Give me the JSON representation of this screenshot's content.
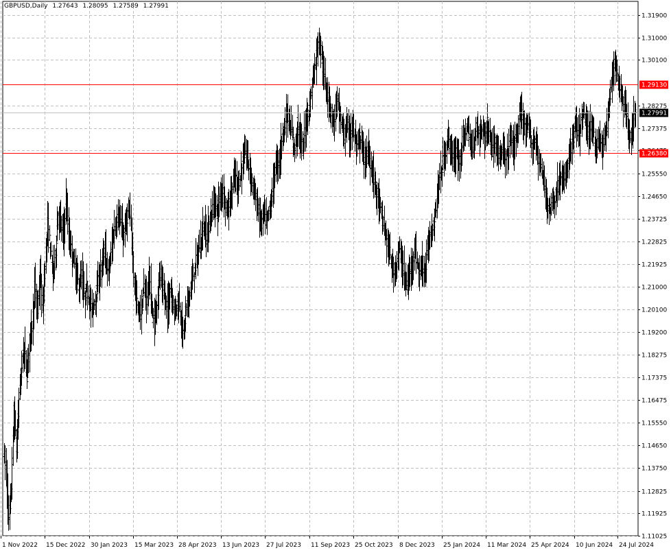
{
  "header": {
    "symbol": "GBPUSD,Daily",
    "open": "1.27643",
    "high": "1.28095",
    "low": "1.27589",
    "close": "1.27991"
  },
  "colors": {
    "background": "#ffffff",
    "bars": "#000000",
    "grid": "#c0c0c0",
    "level_line": "#ff0000",
    "level_label_bg": "#ff0000",
    "level_label_text": "#ffffff",
    "price_label_bg": "#000000",
    "price_label_text": "#ffffff"
  },
  "chart_data": {
    "type": "ohlc",
    "x_tick_labels": [
      "1 Nov 2022",
      "15 Dec 2022",
      "30 Jan 2023",
      "15 Mar 2023",
      "28 Apr 2023",
      "13 Jun 2023",
      "27 Jul 2023",
      "11 Sep 2023",
      "25 Oct 2023",
      "8 Dec 2023",
      "25 Jan 2024",
      "11 Mar 2024",
      "25 Apr 2024",
      "10 Jun 2024",
      "24 Jul 2024"
    ],
    "y_tick_labels": [
      "1.31900",
      "1.31000",
      "1.30100",
      "1.28275",
      "1.27375",
      "1.26475",
      "1.25550",
      "1.24650",
      "1.23725",
      "1.22825",
      "1.21925",
      "1.21000",
      "1.20100",
      "1.19200",
      "1.18275",
      "1.17375",
      "1.16475",
      "1.15550",
      "1.14650",
      "1.13750",
      "1.12825",
      "1.11925",
      "1.11025"
    ],
    "ylim": [
      1.10908,
      1.32258
    ],
    "grid": true,
    "horizontal_levels": [
      {
        "price": 1.2913,
        "label": "1.29130"
      },
      {
        "price": 1.2638,
        "label": "1.26380"
      }
    ],
    "current_price": {
      "price": 1.27991,
      "label": "1.27991"
    },
    "price_path": [
      [
        1.145,
        1.135,
        1.115,
        1.13,
        1.16,
        1.145,
        1.165,
        1.18,
        1.185,
        1.175,
        1.19,
        1.195,
        1.21,
        1.2,
        1.215,
        1.2,
        1.22,
        1.235,
        1.225,
        1.215,
        1.225,
        1.24,
        1.235,
        1.23,
        1.245,
        1.23,
        1.225,
        1.22,
        1.215,
        1.21,
        1.215,
        1.205,
        1.21,
        1.205,
        1.2,
        1.205,
        1.21,
        1.215,
        1.22,
        1.225,
        1.215,
        1.22,
        1.23,
        1.235,
        1.24,
        1.235,
        1.23,
        1.235,
        1.24,
        1.235,
        1.215,
        1.205,
        1.2
      ],
      [
        1.2,
        1.21,
        1.205,
        1.215,
        1.2,
        1.195,
        1.205,
        1.215,
        1.21,
        1.205,
        1.2,
        1.21,
        1.205,
        1.2,
        1.205,
        1.2,
        1.19,
        1.2,
        1.205,
        1.21,
        1.215,
        1.22,
        1.225,
        1.23,
        1.235,
        1.23,
        1.235,
        1.24,
        1.245,
        1.24,
        1.245,
        1.25,
        1.245,
        1.24,
        1.245,
        1.25,
        1.255,
        1.25,
        1.255,
        1.26,
        1.265,
        1.26,
        1.255,
        1.25,
        1.245,
        1.24,
        1.235,
        1.24,
        1.235,
        1.24,
        1.245,
        1.255,
        1.26
      ],
      [
        1.26,
        1.27,
        1.275,
        1.28,
        1.275,
        1.27,
        1.265,
        1.275,
        1.27,
        1.265,
        1.275,
        1.28,
        1.285,
        1.295,
        1.3,
        1.31,
        1.305,
        1.295,
        1.29,
        1.285,
        1.28,
        1.275,
        1.285,
        1.28,
        1.275,
        1.27,
        1.275,
        1.27,
        1.275,
        1.27,
        1.265,
        1.27,
        1.265,
        1.26,
        1.265,
        1.26,
        1.255,
        1.25,
        1.245,
        1.24,
        1.235,
        1.23,
        1.225,
        1.22,
        1.215,
        1.22,
        1.225,
        1.22,
        1.215,
        1.21,
        1.215,
        1.22,
        1.225
      ],
      [
        1.22,
        1.215,
        1.22,
        1.215,
        1.225,
        1.23,
        1.235,
        1.24,
        1.25,
        1.255,
        1.26,
        1.265,
        1.27,
        1.265,
        1.26,
        1.265,
        1.26,
        1.265,
        1.27,
        1.275,
        1.27,
        1.265,
        1.27,
        1.275,
        1.27,
        1.275,
        1.27,
        1.275,
        1.27,
        1.265,
        1.27,
        1.265,
        1.26,
        1.265,
        1.26,
        1.265,
        1.27,
        1.265,
        1.27,
        1.275,
        1.28,
        1.275,
        1.27,
        1.275,
        1.265,
        1.27,
        1.265,
        1.26,
        1.255,
        1.25,
        1.245,
        1.24,
        1.245
      ],
      [
        1.245,
        1.25,
        1.255,
        1.25,
        1.255,
        1.26,
        1.265,
        1.27,
        1.275,
        1.27,
        1.275,
        1.28,
        1.275,
        1.27,
        1.275,
        1.27,
        1.265,
        1.27,
        1.265,
        1.27,
        1.275,
        1.285,
        1.295,
        1.3,
        1.295,
        1.29,
        1.285,
        1.28,
        1.275,
        1.27,
        1.275,
        1.28
      ]
    ]
  }
}
